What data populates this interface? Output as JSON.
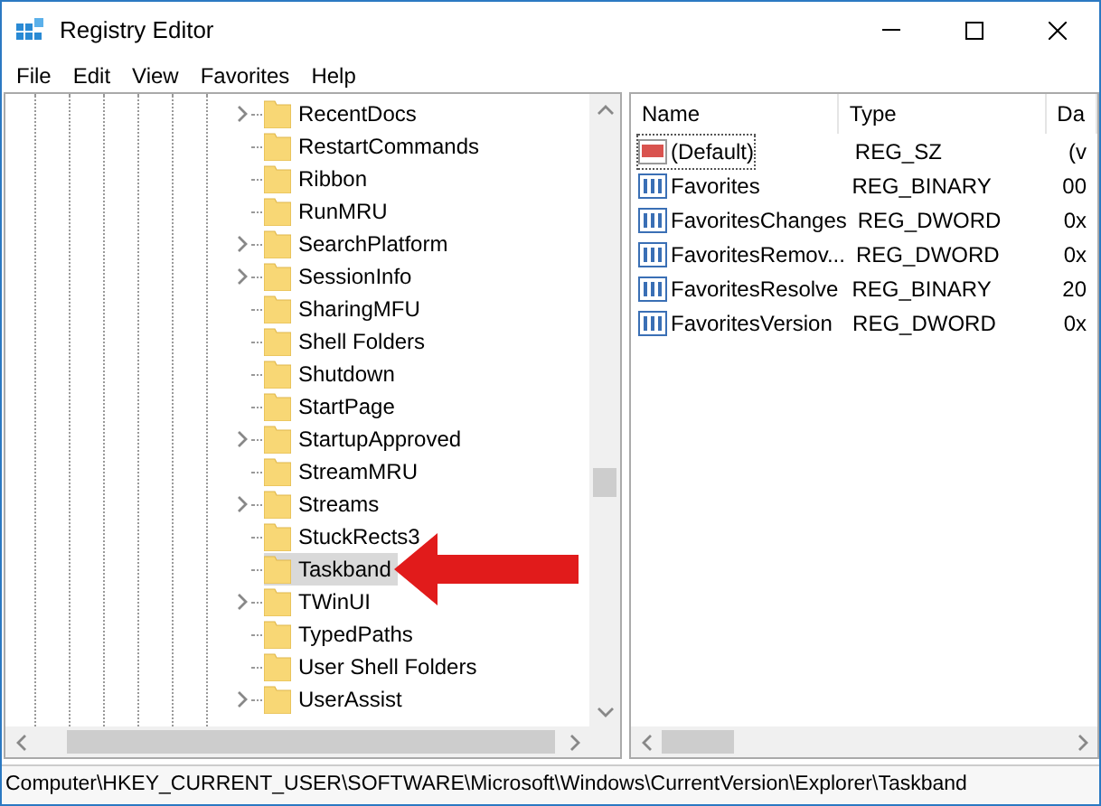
{
  "window": {
    "title": "Registry Editor"
  },
  "menu": [
    "File",
    "Edit",
    "View",
    "Favorites",
    "Help"
  ],
  "tree": {
    "items": [
      {
        "label": "RecentDocs",
        "expandable": true,
        "selected": false
      },
      {
        "label": "RestartCommands",
        "expandable": false,
        "selected": false
      },
      {
        "label": "Ribbon",
        "expandable": false,
        "selected": false
      },
      {
        "label": "RunMRU",
        "expandable": false,
        "selected": false
      },
      {
        "label": "SearchPlatform",
        "expandable": true,
        "selected": false
      },
      {
        "label": "SessionInfo",
        "expandable": true,
        "selected": false
      },
      {
        "label": "SharingMFU",
        "expandable": false,
        "selected": false
      },
      {
        "label": "Shell Folders",
        "expandable": false,
        "selected": false
      },
      {
        "label": "Shutdown",
        "expandable": false,
        "selected": false
      },
      {
        "label": "StartPage",
        "expandable": false,
        "selected": false
      },
      {
        "label": "StartupApproved",
        "expandable": true,
        "selected": false
      },
      {
        "label": "StreamMRU",
        "expandable": false,
        "selected": false
      },
      {
        "label": "Streams",
        "expandable": true,
        "selected": false
      },
      {
        "label": "StuckRects3",
        "expandable": false,
        "selected": false
      },
      {
        "label": "Taskband",
        "expandable": false,
        "selected": true
      },
      {
        "label": "TWinUI",
        "expandable": true,
        "selected": false
      },
      {
        "label": "TypedPaths",
        "expandable": false,
        "selected": false
      },
      {
        "label": "User Shell Folders",
        "expandable": false,
        "selected": false
      },
      {
        "label": "UserAssist",
        "expandable": true,
        "selected": false
      }
    ]
  },
  "values": {
    "columns": [
      "Name",
      "Type",
      "Da"
    ],
    "rows": [
      {
        "kind": "string",
        "name": "(Default)",
        "type": "REG_SZ",
        "data": "(v",
        "selected": true
      },
      {
        "kind": "binary",
        "name": "Favorites",
        "type": "REG_BINARY",
        "data": "00",
        "selected": false
      },
      {
        "kind": "binary",
        "name": "FavoritesChanges",
        "type": "REG_DWORD",
        "data": "0x",
        "selected": false
      },
      {
        "kind": "binary",
        "name": "FavoritesRemov...",
        "type": "REG_DWORD",
        "data": "0x",
        "selected": false
      },
      {
        "kind": "binary",
        "name": "FavoritesResolve",
        "type": "REG_BINARY",
        "data": "20",
        "selected": false
      },
      {
        "kind": "binary",
        "name": "FavoritesVersion",
        "type": "REG_DWORD",
        "data": "0x",
        "selected": false
      }
    ]
  },
  "status_bar": "Computer\\HKEY_CURRENT_USER\\SOFTWARE\\Microsoft\\Windows\\CurrentVersion\\Explorer\\Taskband"
}
